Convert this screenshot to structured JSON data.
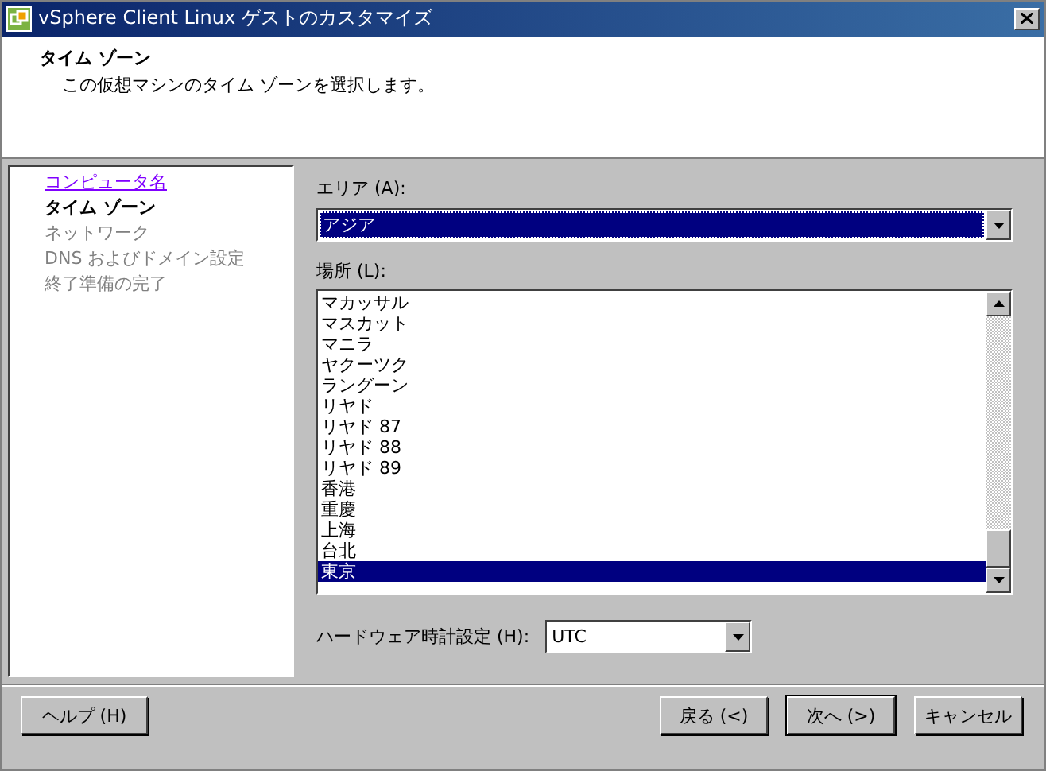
{
  "window": {
    "title": "vSphere Client Linux ゲストのカスタマイズ"
  },
  "header": {
    "title": "タイム ゾーン",
    "subtitle": "この仮想マシンのタイム ゾーンを選択します。"
  },
  "steps": [
    {
      "label": "コンピュータ名",
      "kind": "link"
    },
    {
      "label": "タイム ゾーン",
      "kind": "current"
    },
    {
      "label": "ネットワーク",
      "kind": "disabled"
    },
    {
      "label": "DNS およびドメイン設定",
      "kind": "disabled"
    },
    {
      "label": "終了準備の完了",
      "kind": "disabled"
    }
  ],
  "area": {
    "label": "エリア (A):",
    "value": "アジア"
  },
  "location": {
    "label": "場所 (L):",
    "items": [
      {
        "label": "マカッサル",
        "selected": false
      },
      {
        "label": "マスカット",
        "selected": false
      },
      {
        "label": "マニラ",
        "selected": false
      },
      {
        "label": "ヤクーツク",
        "selected": false
      },
      {
        "label": "ラングーン",
        "selected": false
      },
      {
        "label": "リヤド",
        "selected": false
      },
      {
        "label": "リヤド 87",
        "selected": false
      },
      {
        "label": "リヤド 88",
        "selected": false
      },
      {
        "label": "リヤド 89",
        "selected": false
      },
      {
        "label": "香港",
        "selected": false
      },
      {
        "label": "重慶",
        "selected": false
      },
      {
        "label": "上海",
        "selected": false
      },
      {
        "label": "台北",
        "selected": false
      },
      {
        "label": "東京",
        "selected": true
      }
    ]
  },
  "hardware_clock": {
    "label": "ハードウェア時計設定 (H):",
    "value": "UTC"
  },
  "buttons": {
    "help": "ヘルプ (H)",
    "back": "戻る (<)",
    "next": "次へ (>)",
    "cancel": "キャンセル"
  }
}
